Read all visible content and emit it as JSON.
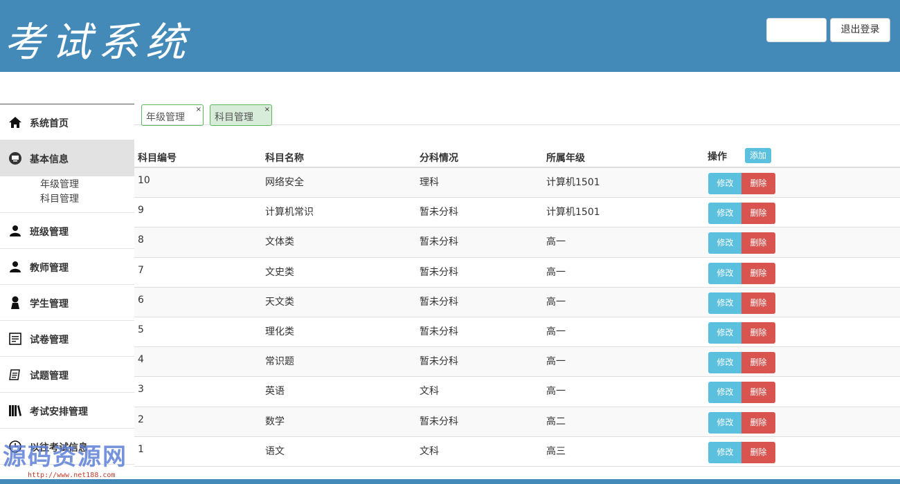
{
  "header": {
    "title": "考试系统",
    "user_label": "",
    "logout_label": "退出登录"
  },
  "sidebar": {
    "items": [
      {
        "label": "系统首页",
        "icon": "home-icon"
      },
      {
        "label": "基本信息",
        "icon": "monitor-icon"
      },
      {
        "label": "班级管理",
        "icon": "users-icon"
      },
      {
        "label": "教师管理",
        "icon": "users-icon"
      },
      {
        "label": "学生管理",
        "icon": "user-icon"
      },
      {
        "label": "试卷管理",
        "icon": "list-icon"
      },
      {
        "label": "试题管理",
        "icon": "document-icon"
      },
      {
        "label": "考试安排管理",
        "icon": "books-icon"
      },
      {
        "label": "以往考试信息",
        "icon": "clock-icon"
      }
    ],
    "sub_items": [
      "年级管理",
      "科目管理"
    ]
  },
  "tabs": [
    {
      "label": "年级管理",
      "close": "×"
    },
    {
      "label": "科目管理",
      "close": "×"
    }
  ],
  "table": {
    "headers": [
      "科目编号",
      "科目名称",
      "分科情况",
      "所属年级",
      "操作"
    ],
    "add_label": "添加",
    "edit_label": "修改",
    "delete_label": "删除",
    "rows": [
      {
        "id": "10",
        "name": "网络安全",
        "category": "理科",
        "grade": "计算机1501"
      },
      {
        "id": "9",
        "name": "计算机常识",
        "category": "暂未分科",
        "grade": "计算机1501"
      },
      {
        "id": "8",
        "name": "文体类",
        "category": "暂未分科",
        "grade": "高一"
      },
      {
        "id": "7",
        "name": "文史类",
        "category": "暂未分科",
        "grade": "高一"
      },
      {
        "id": "6",
        "name": "天文类",
        "category": "暂未分科",
        "grade": "高一"
      },
      {
        "id": "5",
        "name": "理化类",
        "category": "暂未分科",
        "grade": "高一"
      },
      {
        "id": "4",
        "name": "常识题",
        "category": "暂未分科",
        "grade": "高一"
      },
      {
        "id": "3",
        "name": "英语",
        "category": "文科",
        "grade": "高一"
      },
      {
        "id": "2",
        "name": "数学",
        "category": "暂未分科",
        "grade": "高二"
      },
      {
        "id": "1",
        "name": "语文",
        "category": "文科",
        "grade": "高三"
      }
    ]
  },
  "watermark": {
    "text": "源码资源网",
    "url": "http://www.net188.com"
  },
  "colors": {
    "header_bg": "#448ab8",
    "info": "#5bc0de",
    "danger": "#d9534f",
    "tab_border": "#5cb85c"
  }
}
